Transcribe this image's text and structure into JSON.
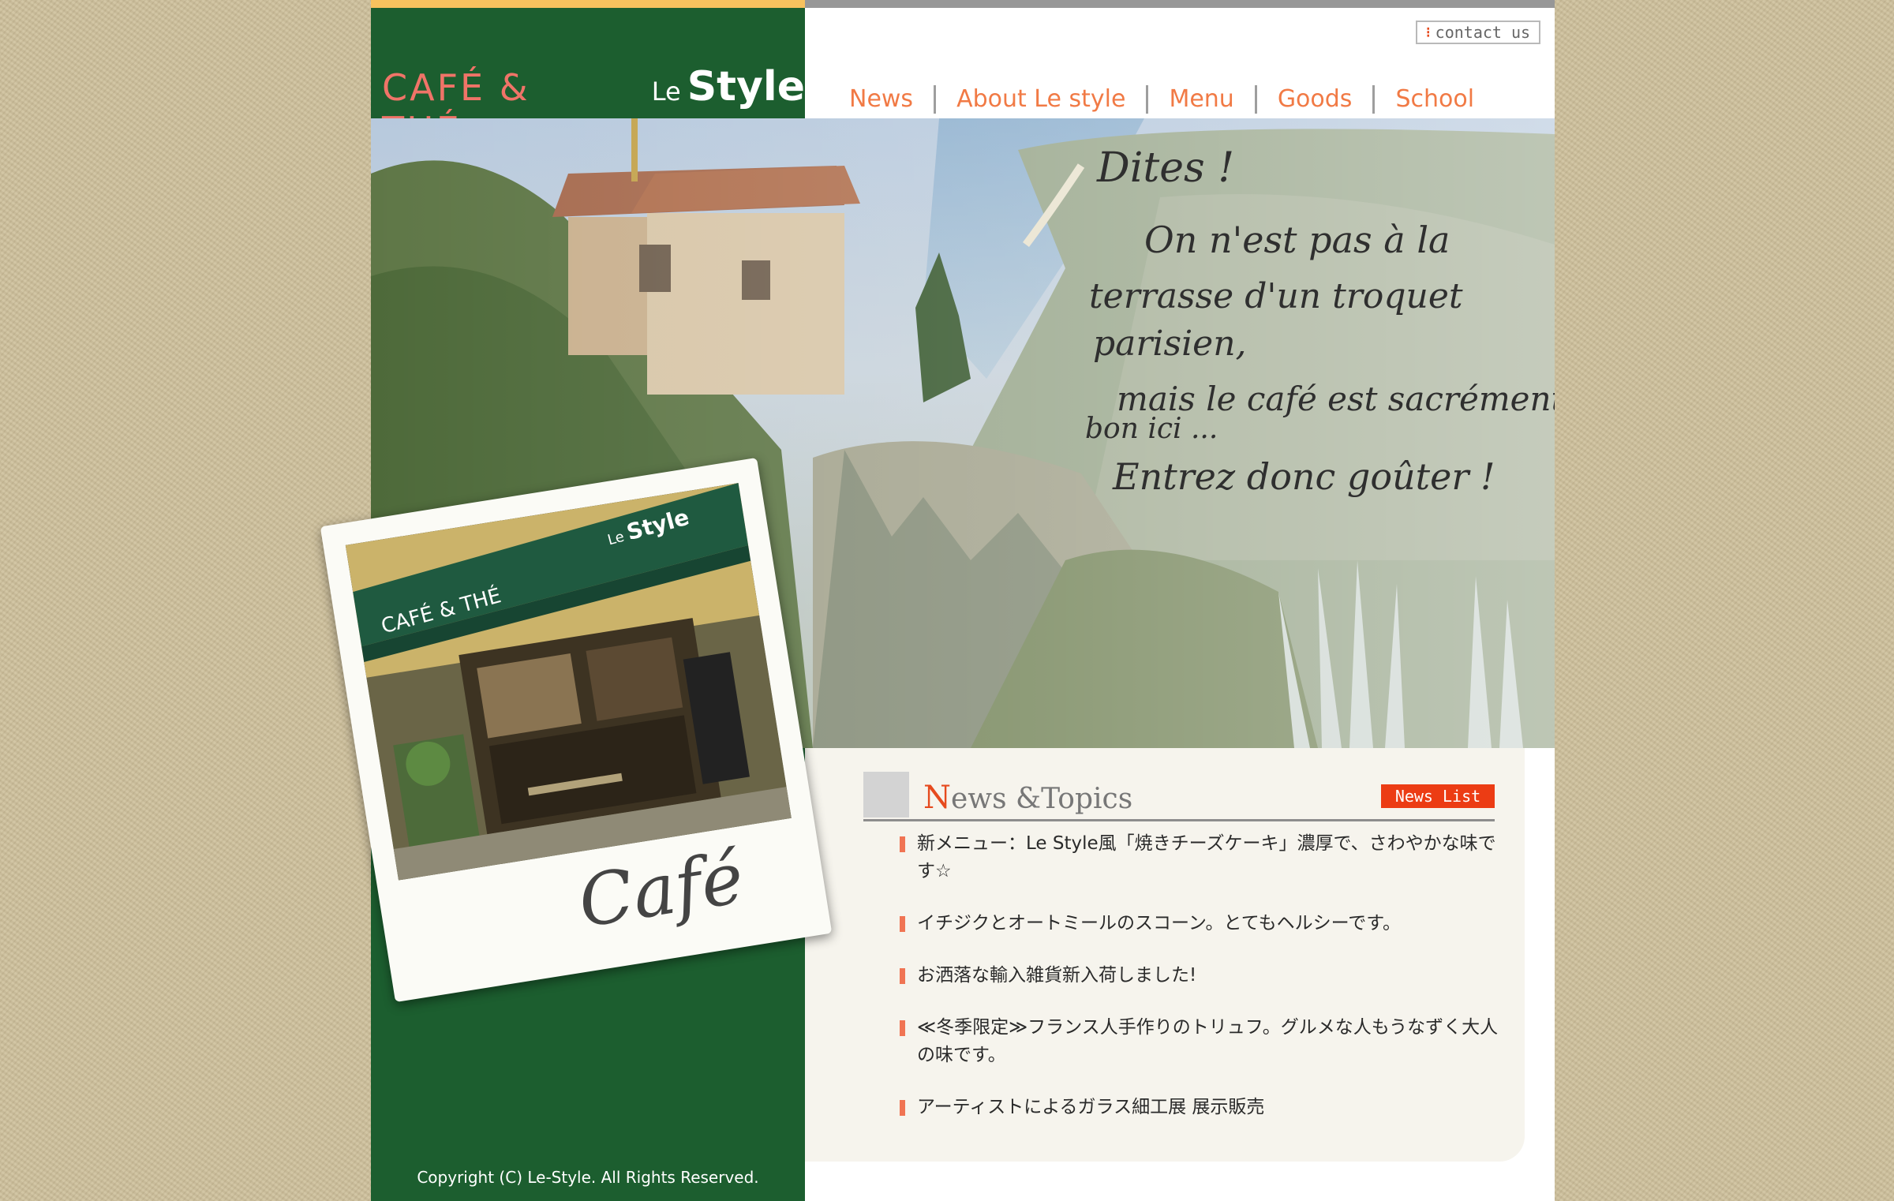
{
  "header": {
    "logo": {
      "cafe": "CAFÉ & THÉ",
      "le": "Le",
      "style": "Style"
    },
    "contact_label": "contact us",
    "nav": [
      "News",
      "About Le style",
      "Menu",
      "Goods",
      "School"
    ]
  },
  "hero": {
    "handwriting": [
      "Dites !",
      "On n'est pas à la",
      "terrasse d'un troquet",
      "parisien,",
      "mais le café est sacrément",
      "bon ici ...",
      "Entrez donc goûter !"
    ],
    "stamp": {
      "awning_cafe": "CAFÉ & THÉ",
      "awning_le": "Le",
      "awning_style": "Style",
      "script": "Café"
    }
  },
  "news": {
    "title_initial": "N",
    "title_rest": "ews &Topics",
    "list_button": "News List",
    "items": [
      "新メニュー：Le Style風「焼きチーズケーキ」濃厚で、さわやかな味です☆",
      "イチジクとオートミールのスコーン。とてもヘルシーです。",
      "お洒落な輸入雑貨新入荷しました!",
      "≪冬季限定≫フランス人手作りのトリュフ。グルメな人もうなずく大人の味です。",
      "アーティストによるガラス細工展 展示販売"
    ]
  },
  "footer": {
    "copyright": "Copyright (C) Le-Style. All Rights Reserved."
  },
  "colors": {
    "brand_green": "#1c5e2f",
    "accent_orange": "#f17a45",
    "news_red": "#ec3c14",
    "top_bar_yellow": "#f7c25e"
  }
}
